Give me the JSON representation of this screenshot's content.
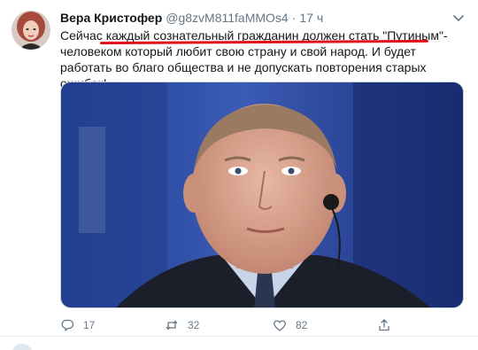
{
  "tweet": {
    "author_name": "Вера Кристофер",
    "handle": "@g8zvM811faMMOs4",
    "separator": "·",
    "time": "17 ч",
    "text_before": "Сейчас ",
    "text_highlight": "каждый сознательный гражданин должен стать \"Путиным\"",
    "text_after": "- человеком который любит свою страну и свой народ. И будет работать во благо общества и не допускать повторения старых ошибок!",
    "highlight_color": "#e0101a",
    "media": {
      "icon": "photo-of-man-with-earpiece"
    },
    "actions": {
      "reply_count": "17",
      "retweet_count": "32",
      "like_count": "82"
    }
  },
  "colors": {
    "text": "#14171a",
    "secondary": "#657786",
    "border": "#e6ecf0"
  }
}
